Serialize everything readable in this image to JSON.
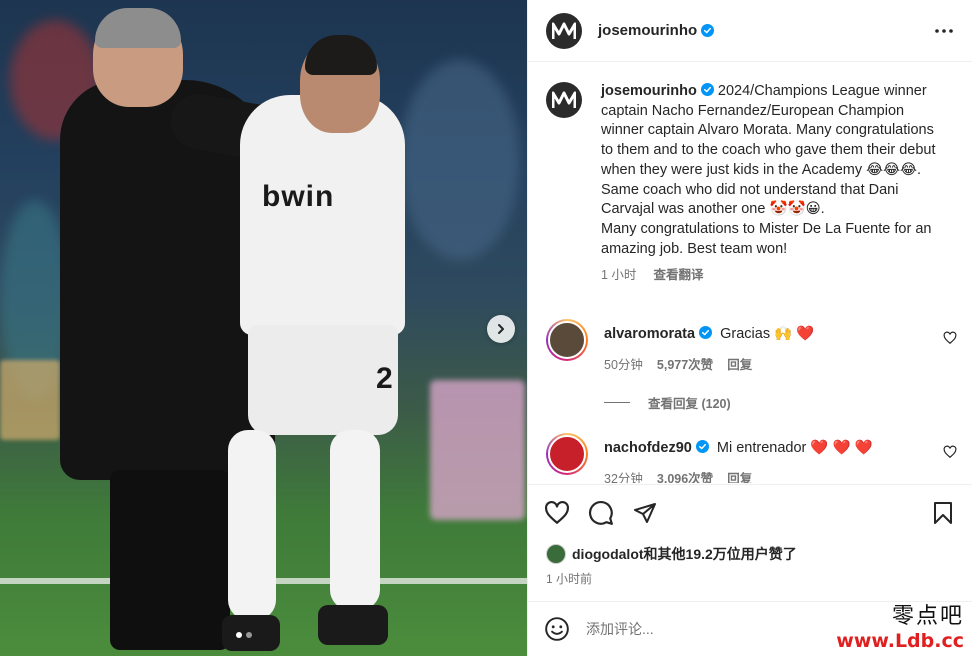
{
  "post": {
    "username": "josemourinho",
    "avatar_initials": "M",
    "more_icon": "more-horizontal-icon"
  },
  "photo": {
    "sponsor_text": "bwin",
    "shorts_number": "2",
    "next_icon": "chevron-right-icon"
  },
  "caption": {
    "username": "josemourinho",
    "text": "2024/Champions League winner captain Nacho Fernandez/European Champion winner captain Alvaro Morata. Many congratulations to them and to the coach who gave them their debut when they were just kids in the Academy 😂😂😂. Same coach who did not understand that Dani Carvajal was another one 🤡🤡😀.\nMany congratulations to Mister De La Fuente for an amazing job. Best team won!",
    "time": "1 小时",
    "translate": "查看翻译"
  },
  "comments": [
    {
      "username": "alvaromorata",
      "text": "Gracias 🙌 ❤️",
      "time": "50分钟",
      "likes": "5,977次赞",
      "reply": "回复",
      "view_replies": "查看回复 (120)"
    },
    {
      "username": "nachofdez90",
      "text": "Mi entrenador ❤️ ❤️ ❤️",
      "time": "32分钟",
      "likes": "3,096次赞",
      "reply": "回复"
    }
  ],
  "likes_summary": {
    "text": "diogodalot和其他19.2万位用户赞了"
  },
  "timestamp": "1 小时前",
  "comment_input": {
    "placeholder": "添加评论..."
  },
  "watermark": {
    "line1": "零点吧",
    "line2": "www.Ldb.cc"
  },
  "colors": {
    "verified": "#0095f6",
    "heart_red": "#ed4956",
    "muted_text": "#737373"
  }
}
